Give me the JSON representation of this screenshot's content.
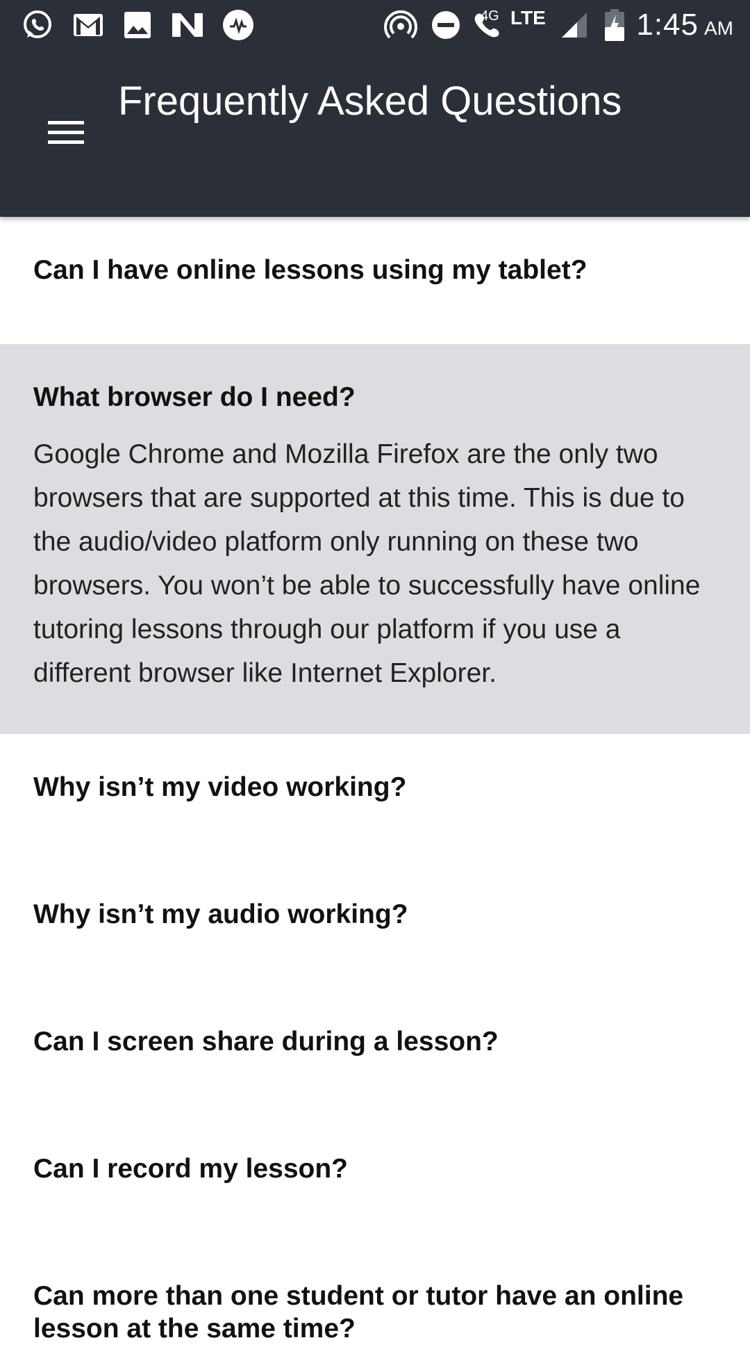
{
  "status_bar": {
    "icons": [
      "whatsapp-icon",
      "gmail-icon",
      "image-icon",
      "n-app-icon",
      "audio-app-icon",
      "hotspot-icon",
      "do-not-disturb-icon",
      "wifi-calling-icon",
      "signal-icon",
      "battery-icon"
    ],
    "call_network": "4G",
    "network": "LTE",
    "time": "1:45",
    "ampm": "AM"
  },
  "app_bar": {
    "title": "Frequently Asked Questions",
    "menu_icon": "hamburger-menu-icon"
  },
  "faq": [
    {
      "question": "Can I have online lessons using my tablet?",
      "expanded": false,
      "answer": ""
    },
    {
      "question": "What browser do I need?",
      "expanded": true,
      "answer": "Google Chrome and Mozilla Firefox are the only two browsers that are supported at this time. This is due to the audio/video platform only running on these two browsers. You won’t be able to successfully have online tutoring lessons through our platform if you use a different browser like Internet Explorer."
    },
    {
      "question": "Why isn’t my video working?",
      "expanded": false,
      "answer": ""
    },
    {
      "question": "Why isn’t my audio working?",
      "expanded": false,
      "answer": ""
    },
    {
      "question": "Can I screen share during a lesson?",
      "expanded": false,
      "answer": ""
    },
    {
      "question": "Can I record my lesson?",
      "expanded": false,
      "answer": ""
    },
    {
      "question": "Can more than one student or tutor have an online lesson at the same time?",
      "expanded": false,
      "answer": ""
    }
  ],
  "colors": {
    "app_bar": "#2b2f38",
    "expanded_item": "#dcdde1",
    "text": "#111111"
  }
}
